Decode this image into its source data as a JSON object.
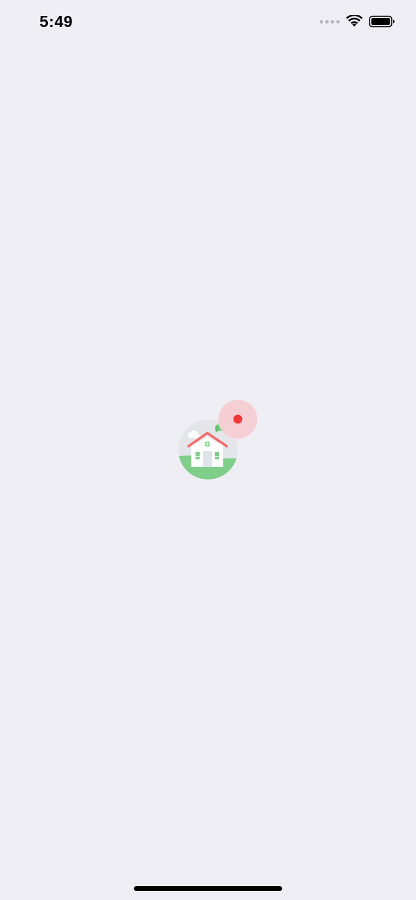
{
  "status_bar": {
    "time": "5:49",
    "icons": [
      "cellular-signal-icon",
      "wifi-icon",
      "battery-icon"
    ]
  },
  "splash": {
    "logo_icon": "house-logo-icon",
    "notification_icon": "red-dot-icon",
    "colors": {
      "background": "#f0eef5",
      "logo_circle": "#e4e5ea",
      "grass": "#7fcf8a",
      "roof": "#f26b6b",
      "leaf": "#67c06b",
      "notification_halo": "#f5cfd4",
      "notification_dot": "#f03a3a"
    }
  }
}
